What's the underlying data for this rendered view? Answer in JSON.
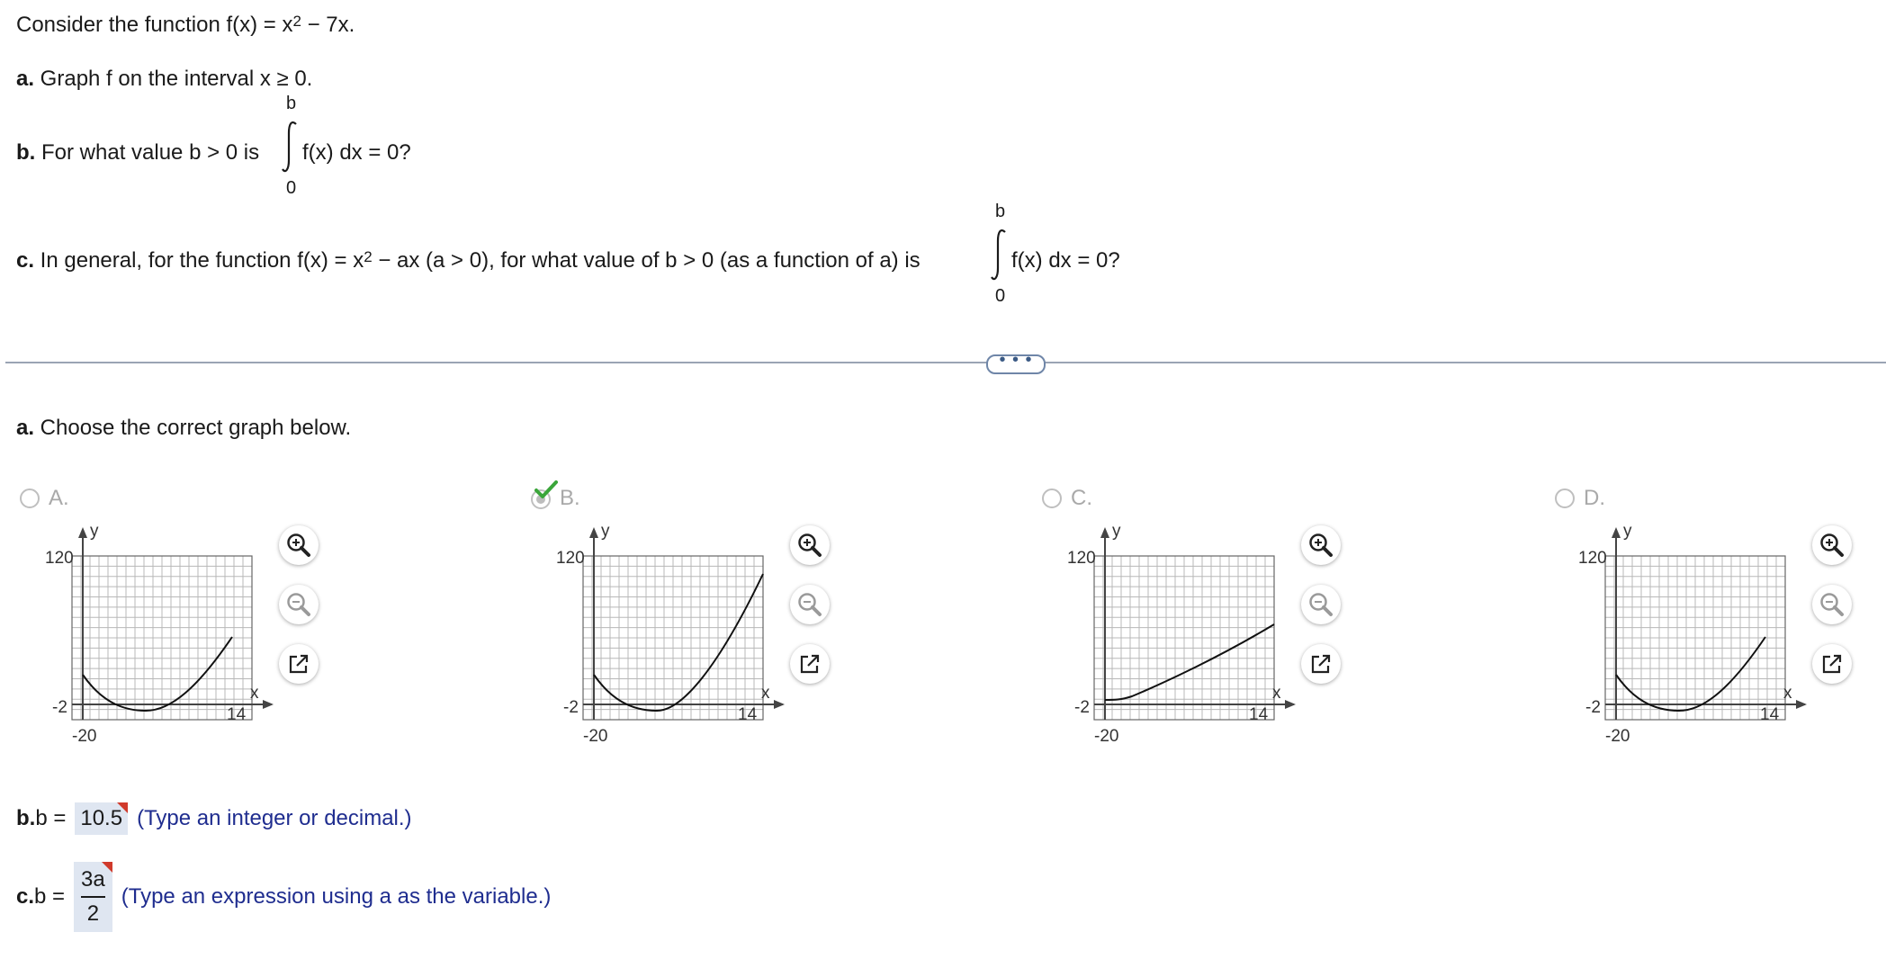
{
  "problem": {
    "intro_prefix": "Consider the function f(x) = x",
    "intro_exp": "2",
    "intro_suffix": " − 7x.",
    "a_label": "a.",
    "a_text": " Graph f on the interval x ≥ 0.",
    "b_label": "b.",
    "b_text": " For what value b > 0 is",
    "b_integrand": "f(x) dx = 0?",
    "int_upper": "b",
    "int_lower": "0",
    "c_label": "c.",
    "c_text_1": " In general, for the function f(x) = x",
    "c_exp": "2",
    "c_text_2": " − ax (a > 0), for what value of b > 0 (as a function of a) is",
    "c_integrand": "f(x) dx = 0?"
  },
  "more_button_label": "• • •",
  "part_a": {
    "prompt_label": "a.",
    "prompt_text": " Choose the correct graph below.",
    "options": [
      {
        "letter": "A.",
        "selected": false,
        "curve": "min_low_right_mid"
      },
      {
        "letter": "B.",
        "selected": true,
        "curve": "min_low_right_high"
      },
      {
        "letter": "C.",
        "selected": false,
        "curve": "increasing_from_zero"
      },
      {
        "letter": "D.",
        "selected": false,
        "curve": "min_low_right_mid"
      }
    ],
    "axis": {
      "x_label": "x",
      "y_label": "y",
      "y_max_tick": "120",
      "y_min_tick": "-2",
      "x_min_tick": "-20",
      "x_max_tick": "14"
    },
    "tool_icons": [
      "zoom-in-icon",
      "zoom-out-icon",
      "open-new-window-icon"
    ]
  },
  "part_b": {
    "label": "b.",
    "prefix": " b =",
    "value": "10.5",
    "hint": "(Type an integer or decimal.)"
  },
  "part_c": {
    "label": "c.",
    "prefix": " b =",
    "numerator": "3a",
    "denominator": "2",
    "hint": "(Type an expression using a as the variable.)"
  },
  "colors": {
    "accent_check": "#3aa63a",
    "divider": "#9aa4b4",
    "hint_text": "#1f2d8f",
    "answer_bg": "#dfe6f1",
    "flag": "#d03a2b"
  }
}
